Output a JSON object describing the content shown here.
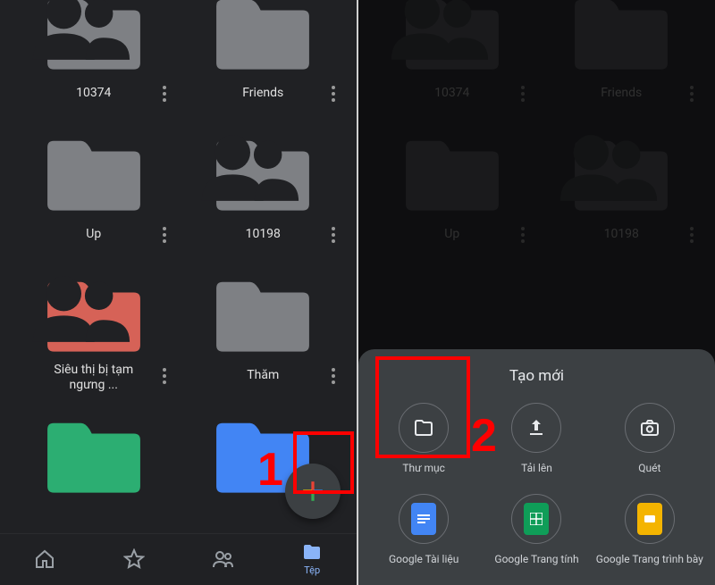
{
  "panelA": {
    "folders": [
      {
        "name": "10374",
        "shared": true,
        "color": "gray"
      },
      {
        "name": "Friends",
        "shared": false,
        "color": "gray"
      },
      {
        "name": "Up",
        "shared": false,
        "color": "gray"
      },
      {
        "name": "10198",
        "shared": true,
        "color": "gray"
      },
      {
        "name": "Siêu thị bị tạm ngưng ...",
        "shared": true,
        "color": "red"
      },
      {
        "name": "Thăm",
        "shared": false,
        "color": "gray"
      },
      {
        "name": "",
        "shared": false,
        "color": "green"
      },
      {
        "name": "",
        "shared": false,
        "color": "blue"
      }
    ],
    "nav": {
      "home": "",
      "starred": "",
      "shared": "",
      "files": "Tệp"
    }
  },
  "panelB": {
    "folders": [
      {
        "name": "10374",
        "shared": true
      },
      {
        "name": "Friends",
        "shared": false
      },
      {
        "name": "Up",
        "shared": false
      },
      {
        "name": "10198",
        "shared": true
      }
    ],
    "sheet": {
      "title": "Tạo mới",
      "items": {
        "folder": "Thư mục",
        "upload": "Tải lên",
        "scan": "Quét",
        "docs": "Google Tài liệu",
        "sheets": "Google Trang tính",
        "slides": "Google Trang trình bày"
      }
    }
  },
  "annotations": {
    "step1": "1",
    "step2": "2"
  },
  "colors": {
    "folderGray": "#7e8084",
    "folderRed": "#d66257",
    "folderGreen": "#2cae72",
    "folderBlue": "#4285f4",
    "folderDim": "#3a3b3f"
  }
}
